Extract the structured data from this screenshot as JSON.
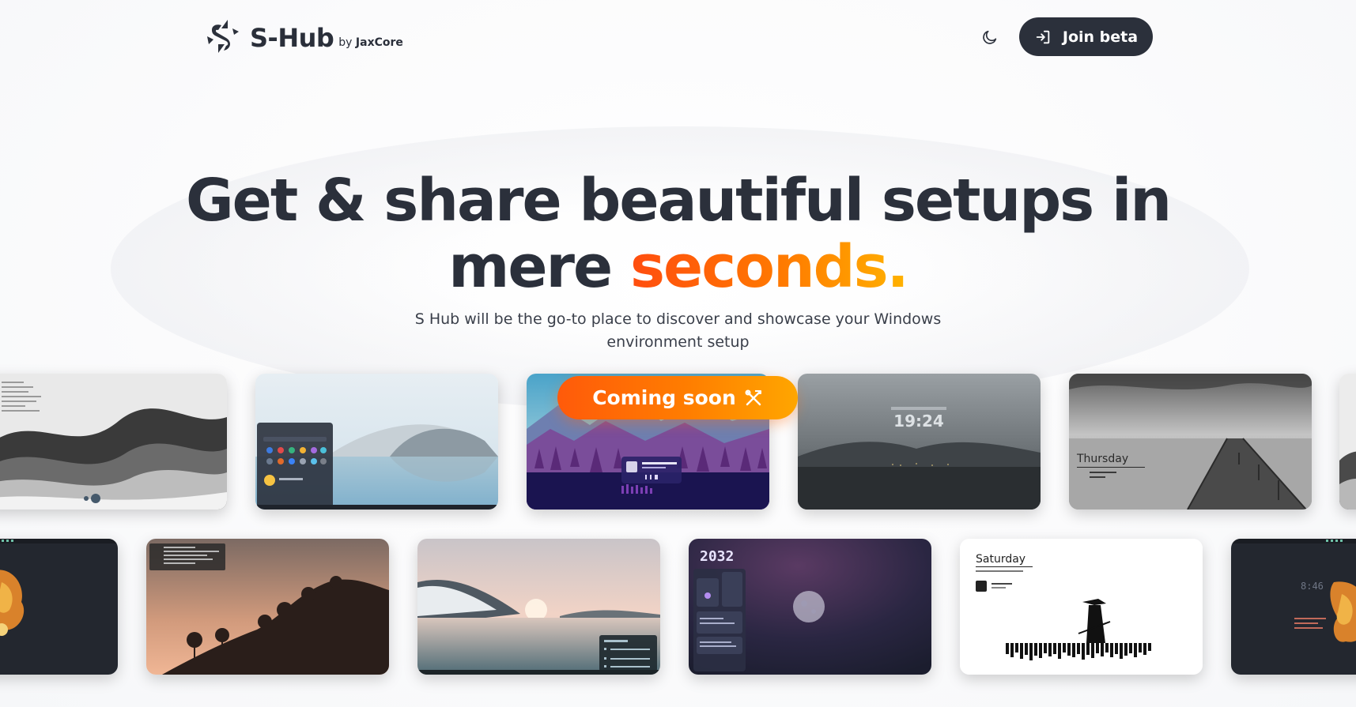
{
  "header": {
    "brand_name": "S-Hub",
    "brand_by_prefix": "by ",
    "brand_by_company": "JaxCore",
    "theme_toggle_icon": "moon-icon",
    "join_button_icon": "sign-in-icon",
    "join_button_label": "Join beta"
  },
  "hero": {
    "headline_line1": "Get & share beautiful setups in",
    "headline_line2_plain": "mere ",
    "headline_line2_accent": "seconds.",
    "subline": "S Hub will be the go-to place to discover and showcase your Windows environment setup",
    "badge_label": "Coming soon",
    "badge_icon": "tools-icon"
  },
  "gallery": {
    "row1": [
      {
        "id": "waves",
        "caption": ""
      },
      {
        "id": "lake-start-menu",
        "caption": ""
      },
      {
        "id": "mountain-music",
        "caption": ""
      },
      {
        "id": "foggy-clock",
        "caption": "19:24"
      },
      {
        "id": "pier-thursday",
        "caption": "Thursday"
      },
      {
        "id": "edge-partial",
        "caption": ""
      }
    ],
    "row2": [
      {
        "id": "dragon-left",
        "caption": ""
      },
      {
        "id": "sunset-hill",
        "caption": ""
      },
      {
        "id": "sunrise-lake",
        "caption": ""
      },
      {
        "id": "moon-dashboard",
        "caption": "2032"
      },
      {
        "id": "samurai-saturday",
        "caption": "Saturday"
      },
      {
        "id": "dragon-right",
        "caption": "8:46"
      }
    ]
  },
  "colors": {
    "ink": "#2b303b",
    "accent_start": "#ff4d0f",
    "accent_end": "#ffb300"
  }
}
